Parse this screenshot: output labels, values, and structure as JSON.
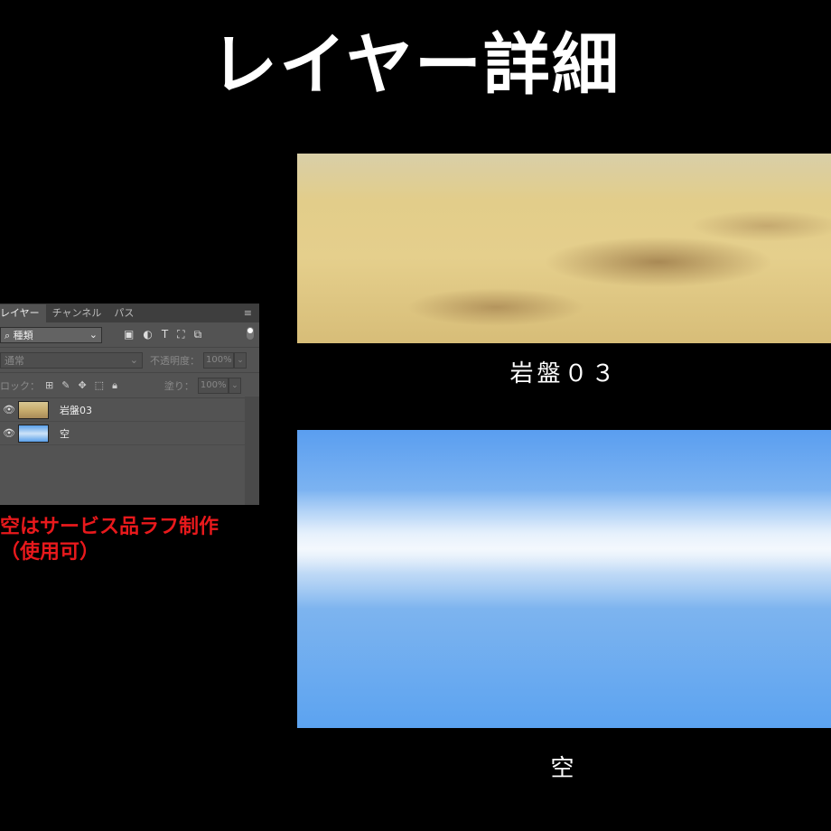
{
  "title": "レイヤー詳細",
  "layers_panel": {
    "tabs": [
      "レイヤー",
      "チャンネル",
      "パス"
    ],
    "filter_label": "種類",
    "blend_mode": "通常",
    "opacity_label": "不透明度：",
    "opacity_value": "100%",
    "lock_label": "ロック：",
    "fill_label": "塗り：",
    "fill_value": "100%",
    "layers": [
      {
        "name": "岩盤03",
        "visible": true
      },
      {
        "name": "空",
        "visible": true
      }
    ]
  },
  "note": {
    "line1": "空はサービス品ラフ制作",
    "line2": "（使用可）",
    "color": "#e8191c"
  },
  "images": {
    "bedrock_caption": "岩盤０３",
    "sky_caption": "空"
  }
}
